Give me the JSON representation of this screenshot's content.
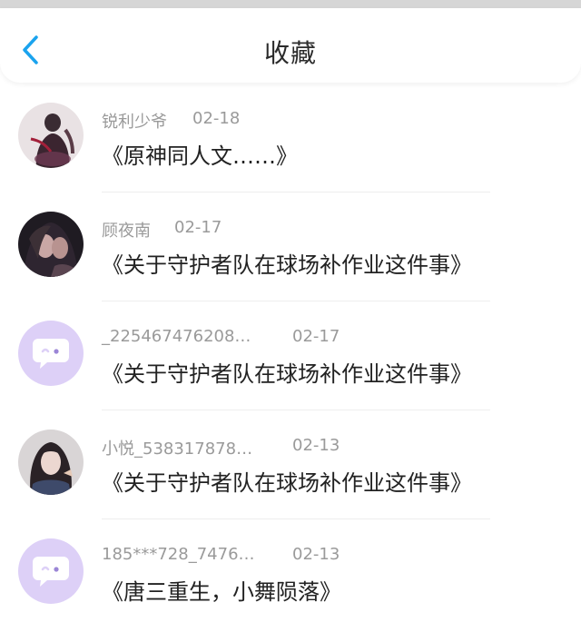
{
  "header": {
    "title": "收藏",
    "back_icon": "chevron-left-icon",
    "accent": "#1aa3ee"
  },
  "items": [
    {
      "user": "锐利少爷",
      "date": "02-18",
      "work": "《原神同人文……》",
      "avatar": "photo-avatar"
    },
    {
      "user": "顾夜南",
      "date": "02-17",
      "work": "《关于守护者队在球场补作业这件事》",
      "avatar": "photo-avatar"
    },
    {
      "user": "_225467476208…",
      "date": "02-17",
      "work": "《关于守护者队在球场补作业这件事》",
      "avatar": "default-chat-avatar"
    },
    {
      "user": "小悦_538317878…",
      "date": "02-13",
      "work": "《关于守护者队在球场补作业这件事》",
      "avatar": "photo-avatar"
    },
    {
      "user": "185***728_7476…",
      "date": "02-13",
      "work": "《唐三重生，小舞陨落》",
      "avatar": "default-chat-avatar"
    }
  ],
  "colors": {
    "default_avatar_bg": "#ddd0f7",
    "default_avatar_icon": "#ffffff"
  }
}
